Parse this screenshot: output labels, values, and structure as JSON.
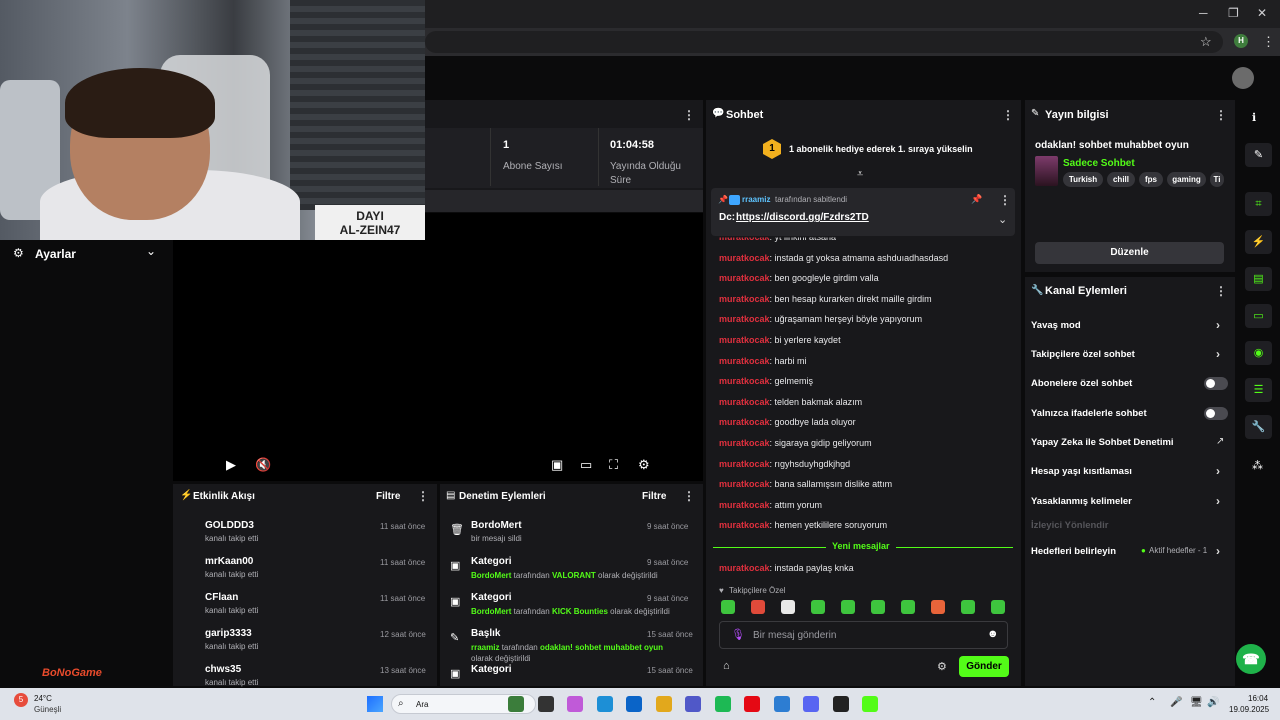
{
  "window": {
    "minimize": "─",
    "restore": "❐",
    "close": "✕",
    "bookmark": "☆",
    "profile": "H",
    "menu": "⋮"
  },
  "stats": {
    "subs_value": "1",
    "subs_label_1": "Abone Sayısı",
    "uptime_value": "01:04:58",
    "uptime_label_1": "Yayında Olduğu",
    "uptime_label_2": "Süre"
  },
  "webcam_sign": {
    "line1": "DAYI",
    "line2": "AL-ZEIN47"
  },
  "settings": {
    "label": "Ayarlar"
  },
  "watermark": "BoNoGame",
  "activity": {
    "title": "Etkinlik Akışı",
    "filter": "Filtre",
    "items": [
      {
        "name": "GOLDDD3",
        "sub": "kanalı takip etti",
        "time": "11 saat önce"
      },
      {
        "name": "mrKaan00",
        "sub": "kanalı takip etti",
        "time": "11 saat önce"
      },
      {
        "name": "CFlaan",
        "sub": "kanalı takip etti",
        "time": "11 saat önce"
      },
      {
        "name": "garip3333",
        "sub": "kanalı takip etti",
        "time": "12 saat önce"
      },
      {
        "name": "chws35",
        "sub": "kanalı takip etti",
        "time": "13 saat önce"
      }
    ]
  },
  "moderation": {
    "title": "Denetim Eylemleri",
    "filter": "Filtre",
    "items": [
      {
        "title": "BordoMert",
        "sub": "bir mesajı sildi",
        "time": "9 saat önce"
      },
      {
        "title": "Kategori",
        "actor": "BordoMert",
        "mid": " tarafından ",
        "value": "VALORANT",
        "tail": " olarak değiştirildi",
        "time": "9 saat önce"
      },
      {
        "title": "Kategori",
        "actor": "BordoMert",
        "mid": " tarafından ",
        "value": "KICK Bounties",
        "tail": " olarak değiştirildi",
        "time": "9 saat önce"
      },
      {
        "title": "Başlık",
        "actor": "rraamiz",
        "mid": " tarafından ",
        "value": "odaklan! sohbet muhabbet oyun",
        "tail": "olarak değiştirildi",
        "time": "15 saat önce"
      },
      {
        "title": "Kategori",
        "time": "15 saat önce"
      }
    ]
  },
  "chat": {
    "title": "Sohbet",
    "goal_badge": "1",
    "goal_text": "1 abonelik hediye ederek 1. sıraya yükselin",
    "pinned_by": "rraamiz",
    "pinned_suffix": "tarafından sabitlendi",
    "pinned_prefix": "Dc: ",
    "pinned_link": "https://discord.gg/Fzdrs2TD",
    "messages": [
      {
        "user": "muratkocak",
        "text": ": yt linkini atsana"
      },
      {
        "user": "muratkocak",
        "text": ": instada gt yoksa atmama ashduıadhasdasd"
      },
      {
        "user": "muratkocak",
        "text": ": ben googleyle girdim valla"
      },
      {
        "user": "muratkocak",
        "text": ": ben hesap kurarken direkt maille girdim"
      },
      {
        "user": "muratkocak",
        "text": ": uğraşamam herşeyi böyle yapıyorum"
      },
      {
        "user": "muratkocak",
        "text": ": bi yerlere kaydet"
      },
      {
        "user": "muratkocak",
        "text": ": harbi mi"
      },
      {
        "user": "muratkocak",
        "text": ": gelmemiş"
      },
      {
        "user": "muratkocak",
        "text": ": telden bakmak alazım"
      },
      {
        "user": "muratkocak",
        "text": ": goodbye lada oluyor"
      },
      {
        "user": "muratkocak",
        "text": ": sigaraya gidip geliyorum"
      },
      {
        "user": "muratkocak",
        "text": ": rıgyhsduyhgdkjhgd"
      },
      {
        "user": "muratkocak",
        "text": ": bana sallamışsın dislike attım"
      },
      {
        "user": "muratkocak",
        "text": ": attım yorum"
      },
      {
        "user": "muratkocak",
        "text": ": hemen yetkililere soruyorum"
      }
    ],
    "new_label": "Yeni mesajlar",
    "new_message": {
      "user": "muratkocak",
      "text": ": instada paylaş knka"
    },
    "followers_only": "Takipçilere Özel",
    "placeholder": "Bir mesaj gönderin",
    "send": "Gönder"
  },
  "stream_info": {
    "title_header": "Yayın bilgisi",
    "stream_title": "odaklan! sohbet muhabbet oyun",
    "category": "Sadece Sohbet",
    "tags": [
      "Turkish",
      "chill",
      "fps",
      "gaming",
      "Ti"
    ],
    "edit": "Düzenle"
  },
  "channel_actions": {
    "title": "Kanal Eylemleri",
    "items": [
      {
        "label": "Yavaş mod"
      },
      {
        "label": "Takipçilere özel sohbet"
      },
      {
        "label": "Abonelere özel sohbet"
      },
      {
        "label": "Yalnızca ifadelerle sohbet"
      },
      {
        "label": "Yapay Zeka ile Sohbet Denetimi"
      },
      {
        "label": "Hesap yaşı kısıtlaması"
      },
      {
        "label": "Yasaklanmış kelimeler"
      },
      {
        "label": "İzleyici Yönlendir"
      },
      {
        "label": "Hedefleri belirleyin"
      }
    ],
    "active_goals": "Aktif hedefler - 1"
  },
  "taskbar": {
    "weather_temp": "24°C",
    "weather_desc": "Güneşli",
    "weather_badge": "5",
    "search": "Ara",
    "time": "16:04",
    "date": "19.09.2025"
  },
  "colors": {
    "accent": "#53fc18",
    "username": "#e0303e",
    "panel": "#18181b"
  }
}
